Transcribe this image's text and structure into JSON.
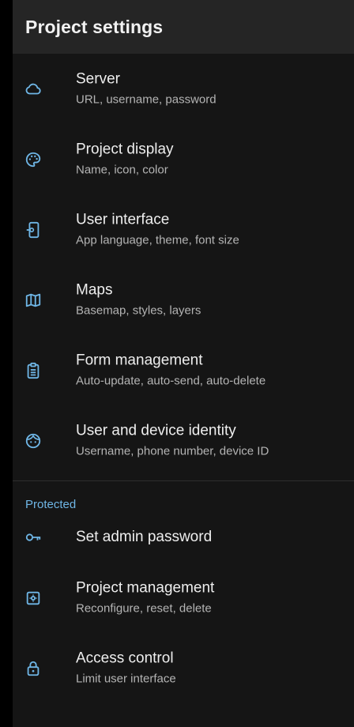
{
  "header": {
    "title": "Project settings"
  },
  "items": [
    {
      "icon": "cloud-icon",
      "title": "Server",
      "summary": "URL, username, password"
    },
    {
      "icon": "palette-icon",
      "title": "Project display",
      "summary": "Name, icon, color"
    },
    {
      "icon": "phone-settings-icon",
      "title": "User interface",
      "summary": "App language, theme, font size"
    },
    {
      "icon": "map-icon",
      "title": "Maps",
      "summary": "Basemap, styles, layers"
    },
    {
      "icon": "clipboard-icon",
      "title": "Form management",
      "summary": "Auto-update, auto-send, auto-delete"
    },
    {
      "icon": "face-icon",
      "title": "User and device identity",
      "summary": "Username, phone number, device ID"
    }
  ],
  "protected": {
    "header": "Protected",
    "items": [
      {
        "icon": "key-icon",
        "title": "Set admin password"
      },
      {
        "icon": "admin-settings-icon",
        "title": "Project management",
        "summary": "Reconfigure, reset, delete"
      },
      {
        "icon": "lock-icon",
        "title": "Access control",
        "summary": "Limit user interface"
      }
    ]
  },
  "colors": {
    "accent": "#6fb6e6",
    "background": "#151515",
    "appbar": "#252525"
  }
}
